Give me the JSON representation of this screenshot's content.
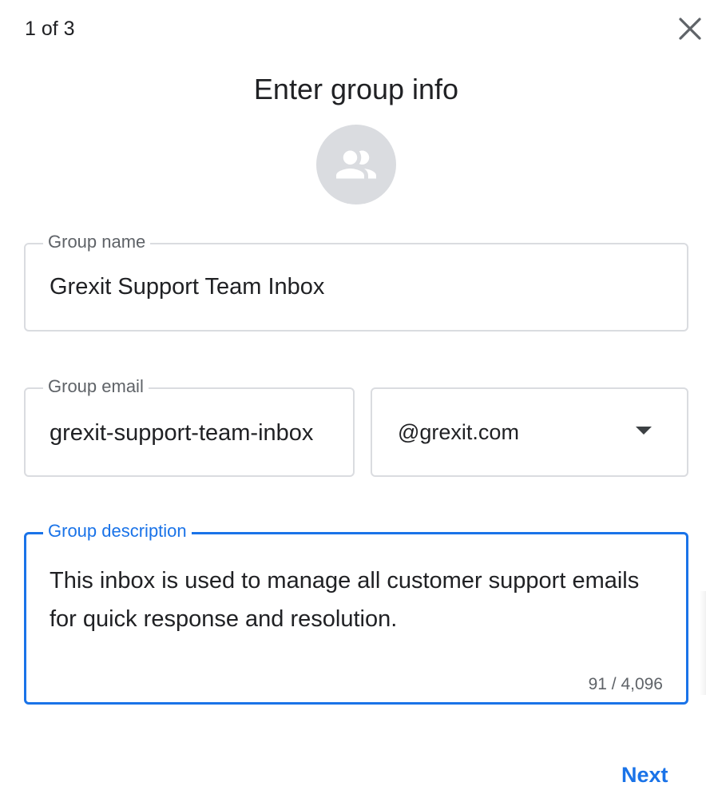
{
  "dialog": {
    "step": "1 of 3",
    "title": "Enter group info",
    "close_icon": "close-icon",
    "avatar_icon": "group-icon"
  },
  "form": {
    "group_name": {
      "label": "Group name",
      "value": "Grexit Support Team Inbox"
    },
    "group_email": {
      "label": "Group email",
      "value": "grexit-support-team-inbox",
      "domain": "@grexit.com"
    },
    "group_description": {
      "label": "Group description",
      "value": "This inbox is used to manage all customer support emails for quick response and resolution.",
      "counter": "91 / 4,096"
    }
  },
  "actions": {
    "next_label": "Next"
  },
  "colors": {
    "accent": "#1a73e8",
    "border": "#dadce0",
    "label": "#5f6368",
    "text": "#202124",
    "avatar_bg": "#dadce0"
  }
}
